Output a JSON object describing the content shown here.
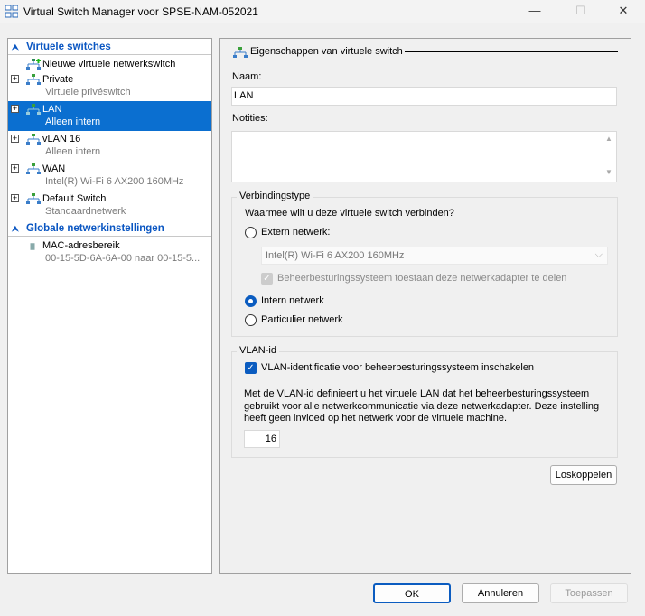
{
  "window": {
    "title": "Virtual Switch Manager voor SPSE-NAM-052021",
    "minimize": "—",
    "maximize": "☐",
    "close": "✕"
  },
  "sidebar": {
    "section_switches": "Virtuele switches",
    "new_switch": "Nieuwe virtuele netwerkswitch",
    "items": [
      {
        "name": "Private",
        "sub": "Virtuele privéswitch"
      },
      {
        "name": "LAN",
        "sub": "Alleen intern"
      },
      {
        "name": "vLAN 16",
        "sub": "Alleen intern"
      },
      {
        "name": "WAN",
        "sub": "Intel(R) Wi-Fi 6 AX200 160MHz"
      },
      {
        "name": "Default Switch",
        "sub": "Standaardnetwerk"
      }
    ],
    "section_global": "Globale netwerkinstellingen",
    "mac": {
      "name": "MAC-adresbereik",
      "sub": "00-15-5D-6A-6A-00 naar 00-15-5..."
    }
  },
  "props": {
    "header": "Eigenschappen van virtuele switch",
    "name_label": "Naam:",
    "name_value": "LAN",
    "notes_label": "Notities:",
    "notes_value": "",
    "conn_legend": "Verbindingstype",
    "conn_question": "Waarmee wilt u deze virtuele switch verbinden?",
    "external": "Extern netwerk:",
    "adapter": "Intel(R) Wi-Fi 6 AX200 160MHz",
    "share": "Beheerbesturingssysteem toestaan deze netwerkadapter te delen",
    "internal": "Intern netwerk",
    "private": "Particulier netwerk",
    "selected": "internal",
    "vlan_legend": "VLAN-id",
    "vlan_check": "VLAN-identificatie voor beheerbesturingssysteem inschakelen",
    "vlan_desc": "Met de VLAN-id definieert u het virtuele LAN dat het beheerbesturingssysteem gebruikt voor alle netwerkcommunicatie via deze netwerkadapter. Deze instelling heeft geen invloed op het netwerk voor de virtuele machine.",
    "vlan_value": "16",
    "disconnect": "Loskoppelen"
  },
  "footer": {
    "ok": "OK",
    "cancel": "Annuleren",
    "apply": "Toepassen"
  }
}
